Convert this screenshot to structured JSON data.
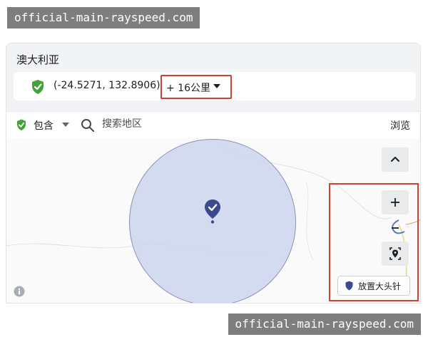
{
  "watermark": {
    "top": "official-main-rayspeed.com",
    "bottom": "official-main-rayspeed.com"
  },
  "location": {
    "country": "澳大利亚",
    "coordinates": "(-24.5271, 132.8906)",
    "radius": "+ 16公里",
    "status_icon": "green-check-shield-icon"
  },
  "filter": {
    "include_label": "包含",
    "search_placeholder": "搜索地区",
    "browse_label": "浏览"
  },
  "map": {
    "drop_pin_label": "放置大头针",
    "pin_color": "#3b4a8c",
    "radius_fill": "#cdd4ec"
  },
  "colors": {
    "accent_green": "#42a33b",
    "highlight_red": "#c8452f"
  }
}
